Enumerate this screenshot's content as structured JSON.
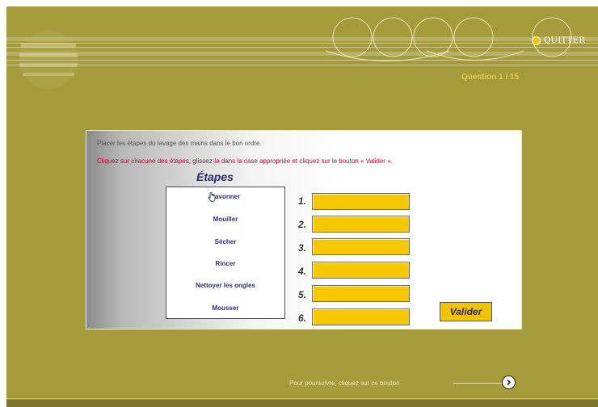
{
  "header": {
    "quit_label": "QUITTER",
    "question_counter": "Question 1 / 15"
  },
  "exercise": {
    "instruction": "Placer les étapes du lavage des mains dans le bon ordre.",
    "instruction_red": "Cliquez sur chacune des étapes, glissez-la dans la case appropriée et cliquez sur le bouton « Valider ».",
    "steps_title": "Étapes",
    "steps": [
      "Savonner",
      "Mouiller",
      "Sécher",
      "Rincer",
      "Nettoyer les ongles",
      "Mousser"
    ],
    "slot_numbers": [
      "1.",
      "2.",
      "3.",
      "4.",
      "5.",
      "6."
    ],
    "slot_values": [
      "",
      "",
      "",
      "",
      "",
      ""
    ],
    "validate_label": "Valider"
  },
  "footer": {
    "continue_text": "Pour poursuivre, cliquez sur ce bouton"
  },
  "colors": {
    "background": "#a59b3b",
    "slot_fill": "#f5c800",
    "step_text": "#2e2e80",
    "instruction_red": "#cc0033",
    "counter_text": "#e8c84a"
  },
  "icons": {
    "quit": "yellow-dot-icon",
    "next": "chevron-right-circle-icon",
    "cursor": "hand-cursor-icon"
  }
}
